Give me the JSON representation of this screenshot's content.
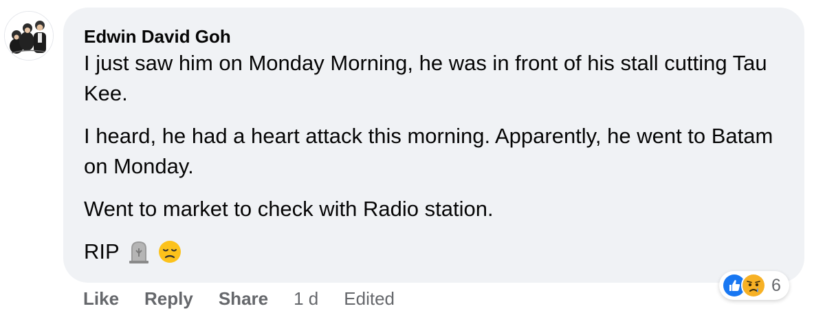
{
  "comment": {
    "author": "Edwin David Goh",
    "paragraphs": [
      "I just saw him on Monday Morning, he was in front of his stall cutting Tau Kee.",
      "I heard, he had a heart attack this morning. Apparently, he went to Batam on Monday.",
      "Went to market to check with Radio station."
    ],
    "last_line": {
      "text": "RIP",
      "emojis": [
        "headstone-emoji",
        "disappointed-face-emoji"
      ]
    }
  },
  "reactions": {
    "icons": [
      "like-reaction-icon",
      "sad-reaction-icon"
    ],
    "count": "6",
    "colors": {
      "like": "#1877f2",
      "sad": "#f7b125"
    }
  },
  "actions": {
    "like": "Like",
    "reply": "Reply",
    "share": "Share",
    "time": "1 d",
    "edited": "Edited"
  },
  "colors": {
    "bubble": "#f0f2f5",
    "text": "#050505",
    "secondary": "#65676b"
  }
}
